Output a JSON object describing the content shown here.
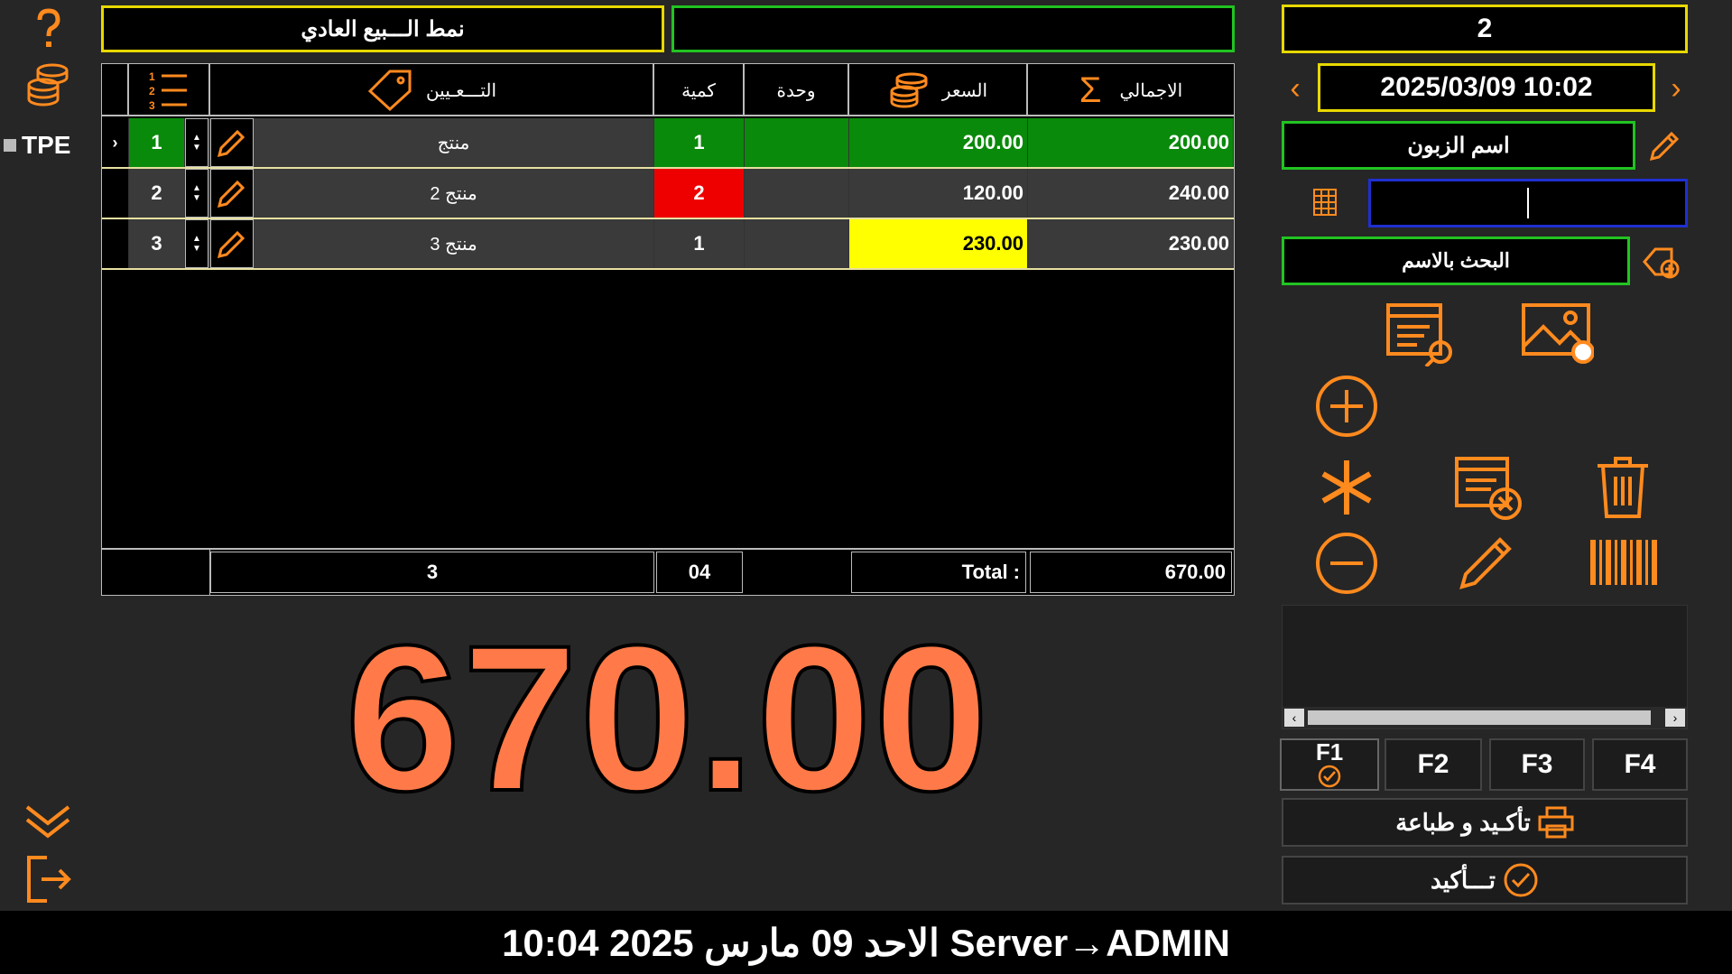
{
  "sidebar": {
    "tpe_label": "TPE"
  },
  "top": {
    "sale_mode": "نمط الـــبيع العادي",
    "ticket_number": "2",
    "datetime": "2025/03/09 10:02",
    "customer_name": "اسم الزبون",
    "code_input_value": "",
    "search_by_name": "البحث بالاسم"
  },
  "table": {
    "headers": {
      "designation": "التـــعـيين",
      "qty": "كمية",
      "unit": "وحدة",
      "price": "السعر",
      "total": "الاجمالي"
    },
    "rows": [
      {
        "num": "1",
        "name": "منتج",
        "qty": "1",
        "unit": "",
        "price": "200.00",
        "total": "200.00"
      },
      {
        "num": "2",
        "name": "منتج 2",
        "qty": "2",
        "unit": "",
        "price": "120.00",
        "total": "240.00"
      },
      {
        "num": "3",
        "name": "منتج 3",
        "qty": "1",
        "unit": "",
        "price": "230.00",
        "total": "230.00"
      }
    ],
    "footer": {
      "item_count": "3",
      "qty_sum": "04",
      "total_label": "Total :",
      "total_value": "670.00"
    }
  },
  "big_total": "670.00",
  "fkeys": [
    "F1",
    "F2",
    "F3",
    "F4"
  ],
  "buttons": {
    "confirm_print": "تأكـيد و طباعة",
    "confirm": "تـــأكيد"
  },
  "status_bar": {
    "text": "10:04  2025 الاحد 09 مارس  Server→ADMIN"
  },
  "colors": {
    "accent": "#ff8a1e",
    "row_selected": "#0a8a0a",
    "qty_alert": "#ee0000",
    "price_alert": "#ffff00"
  }
}
